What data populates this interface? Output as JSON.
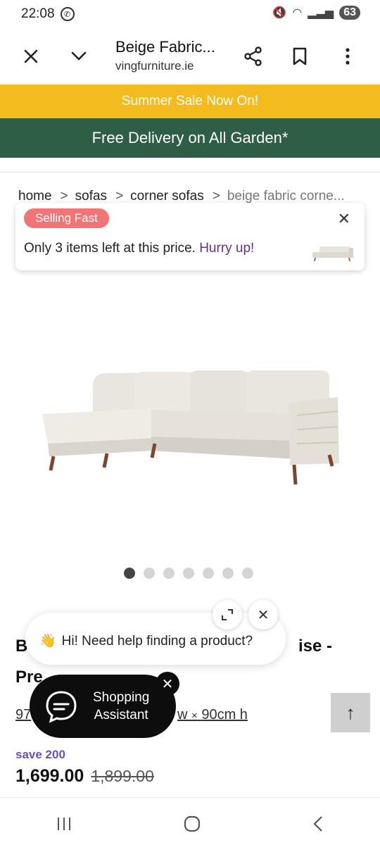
{
  "status_bar": {
    "time": "22:08",
    "battery": "63"
  },
  "browser": {
    "title": "Beige Fabric...",
    "domain": "vingfurniture.ie"
  },
  "banners": {
    "sale": "Summer Sale Now On!",
    "delivery": "Free Delivery on All Garden*"
  },
  "breadcrumb": {
    "items": [
      "home",
      "sofas",
      "corner sofas",
      "beige fabric corne..."
    ],
    "separator": ">"
  },
  "selling_card": {
    "badge": "Selling Fast",
    "text": "Only 3 items left at this price.",
    "cta": "Hurry up!"
  },
  "carousel": {
    "count": 7,
    "active_index": 0
  },
  "product": {
    "title_start": "B",
    "title_end": "ise -",
    "title_line2": "Pre",
    "dims_start": "97",
    "dims_w": "w",
    "dims_sep": "×",
    "dims_h": "90cm h",
    "save": "save 200",
    "price": "1,699.00",
    "old_price": "1,899.00"
  },
  "chat": {
    "emoji": "👋",
    "message": "Hi! Need help finding a product?"
  },
  "assistant": {
    "line1": "Shopping",
    "line2": "Assistant"
  },
  "colors": {
    "sale_banner": "#f4bb1e",
    "delivery_banner": "#2f5e47",
    "badge": "#f27474",
    "hurry": "#6a2f8c",
    "save": "#6a52b5"
  }
}
